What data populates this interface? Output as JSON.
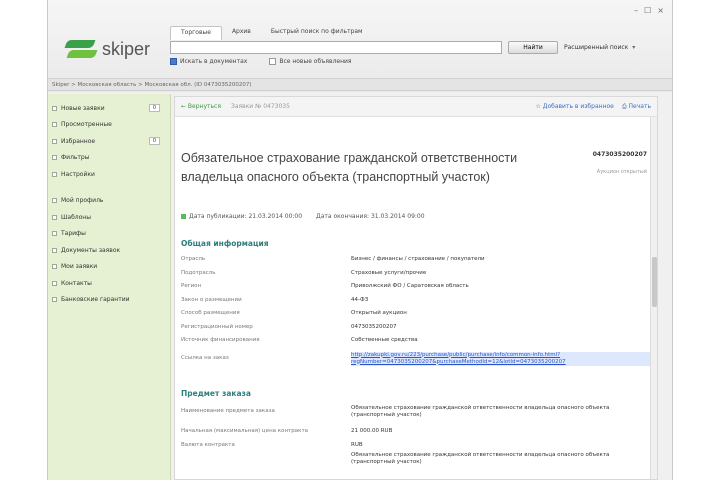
{
  "app": {
    "logo_text": "skiper",
    "brand_color": "#3aa04a"
  },
  "window": {
    "minimize": "–",
    "maximize": "☐",
    "close": "×"
  },
  "tabs": [
    "Торговые",
    "Архив",
    "Быстрый поиск по фильтрам"
  ],
  "search": {
    "value": "",
    "button": "Найти",
    "advanced": "Расширенный поиск"
  },
  "checks": [
    {
      "label": "Искать в документах",
      "checked": true
    },
    {
      "label": "Все новые объявления",
      "checked": false
    }
  ],
  "pathbar": "Skiper > Московская область > Московская обл. (ID 0473035200207)",
  "sidebar": {
    "items": [
      {
        "label": "Новые заявки",
        "badge": "0"
      },
      {
        "label": "Просмотренные",
        "badge": ""
      },
      {
        "label": "Избранное",
        "badge": "0"
      },
      {
        "label": "Фильтры",
        "badge": ""
      },
      {
        "label": "Настройки",
        "badge": ""
      }
    ],
    "items2": [
      {
        "label": "Мой профиль"
      },
      {
        "label": "Шаблоны"
      },
      {
        "label": "Тарифы"
      },
      {
        "label": "Документы заявок"
      },
      {
        "label": "Мои заявки"
      },
      {
        "label": "Контакты"
      },
      {
        "label": "Банковские гарантии"
      }
    ]
  },
  "content": {
    "back": "← Вернуться",
    "crumb": "Заявки № 0473035",
    "actions": [
      "☆ Добавить в избранное",
      "⎙ Печать"
    ],
    "title": "Обязательное страхование гражданской ответственности владельца опасного объекта (транспортный участок)",
    "docnum": "0473035200207",
    "docsub": "Аукцион открытый",
    "date_start_label": "Дата публикации:",
    "date_start": "21.03.2014 00:00",
    "date_end_label": "Дата окончания:",
    "date_end": "31.03.2014 09:00",
    "section1": "Общая информация",
    "info": [
      {
        "k": "Отрасль",
        "v": "Бизнес / финансы / страхование / покупатели"
      },
      {
        "k": "Подотрасль",
        "v": "Страховые услуги/прочие"
      },
      {
        "k": "Регион",
        "v": "Приволжский ФО / Саратовская область"
      },
      {
        "k": "Закон о размещении",
        "v": "44-ФЗ"
      },
      {
        "k": "Способ размещения",
        "v": "Открытый аукцион"
      },
      {
        "k": "Регистрационный номер",
        "v": "0473035200207"
      },
      {
        "k": "Источник финансирования",
        "v": "Собственные средства"
      }
    ],
    "link_label": "Ссылка на заказ",
    "link": "http://zakupki.gov.ru/223/purchase/public/purchase/info/common-info.html?regNumber=0473035200207&purchaseMethodId=12&lotId=0473035200207",
    "section2": "Предмет заказа",
    "info2": [
      {
        "k": "Наименование предмета заказа",
        "v": "Обязательное страхование гражданской ответственности владельца опасного объекта (транспортный участок)"
      },
      {
        "k": "Начальная (максимальная) цена контракта",
        "v": "21 000.00 RUB"
      },
      {
        "k": "Валюта контракта",
        "v": "RUB"
      },
      {
        "k": "",
        "v": "Обязательное страхование гражданской ответственности владельца опасного объекта (транспортный участок)"
      }
    ]
  }
}
